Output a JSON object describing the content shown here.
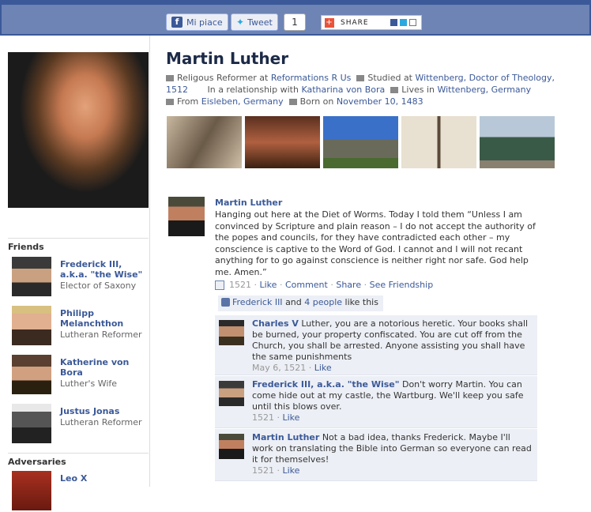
{
  "topbar": {
    "like_label": "Mi piace",
    "tweet_label": "Tweet",
    "tweet_count": "1",
    "share_label": "SHARE"
  },
  "profile": {
    "name": "Martin Luther",
    "job_prefix": "Religous Reformer at",
    "job_org": "Reformations R Us",
    "studied_prefix": "Studied at",
    "studied_place": "Wittenberg, Doctor of Theology,",
    "studied_year": "1512",
    "relationship_prefix": "In a relationship with",
    "relationship_person": "Katharina von Bora",
    "lives_prefix": "Lives in",
    "lives_place": "Wittenberg, Germany",
    "from_prefix": "From",
    "from_place": "Eisleben, Germany",
    "born_prefix": "Born on",
    "born_date": "November 10, 1483"
  },
  "sections": {
    "friends_title": "Friends",
    "adversaries_title": "Adversaries"
  },
  "friends": [
    {
      "name": "Frederick III, a.k.a. \"the Wise\"",
      "desc": "Elector of Saxony"
    },
    {
      "name": "Philipp Melanchthon",
      "desc": "Lutheran Reformer"
    },
    {
      "name": "Katherine von Bora",
      "desc": "Luther's Wife"
    },
    {
      "name": "Justus Jonas",
      "desc": "Lutheran Reformer"
    }
  ],
  "adversaries": [
    {
      "name": "Leo X"
    }
  ],
  "post": {
    "author": "Martin Luther",
    "text": "Hanging out here at the Diet of Worms. Today I told them “Unless I am convinced by Scripture and plain reason – I do not accept the authority of the popes and councils, for they have contradicted each other – my conscience is captive to the Word of God. I cannot and I will not recant anything for to go against conscience is neither right nor safe. God help me. Amen.”",
    "year": "1521",
    "action_like": "Like",
    "action_comment": "Comment",
    "action_share": "Share",
    "action_friendship": "See Friendship",
    "sep": "·",
    "likes_person": "Frederick III",
    "likes_and": "and",
    "likes_count": "4 people",
    "likes_suffix": "like this"
  },
  "comments": [
    {
      "author": "Charles V",
      "text": "Luther, you are a notorious heretic. Your books shall be burned, your property confiscated. You are cut off from the Church, you shall be arrested. Anyone assisting you shall have the same punishments",
      "date": "May 6, 1521",
      "like": "Like"
    },
    {
      "author": "Frederick III, a.k.a. \"the Wise\"",
      "text": "Don't worry Martin. You can come hide out at my castle, the Wartburg. We'll keep you safe until this blows over.",
      "date": "1521",
      "like": "Like"
    },
    {
      "author": "Martin Luther",
      "text": "Not a bad idea, thanks Frederick. Maybe I'll work on translating the Bible into German so everyone can read it for themselves!",
      "date": "1521",
      "like": "Like"
    }
  ]
}
